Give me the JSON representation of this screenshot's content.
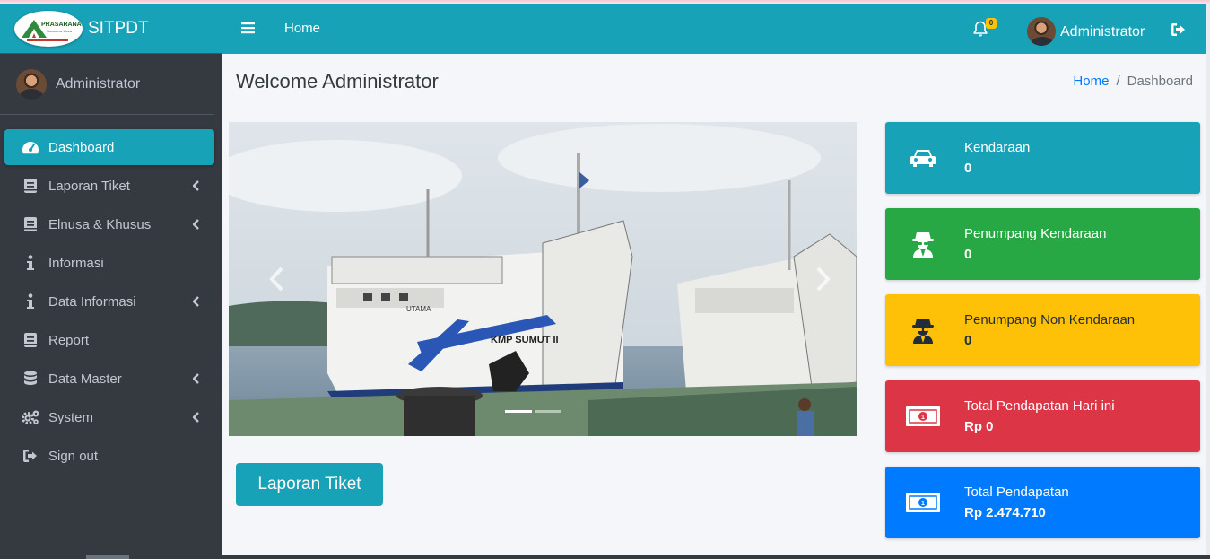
{
  "app": {
    "brand": "SITPDT",
    "logo_text": "PRASARANA",
    "logo_sub": "Sumatera Utara"
  },
  "header": {
    "nav_home": "Home",
    "notification_count": "0",
    "user_name": "Administrator"
  },
  "sidebar": {
    "user_name": "Administrator",
    "items": [
      {
        "label": "Dashboard",
        "icon": "tachometer-icon",
        "active": true,
        "has_caret": false
      },
      {
        "label": "Laporan Tiket",
        "icon": "book-icon",
        "has_caret": true
      },
      {
        "label": "Elnusa & Khusus",
        "icon": "book-icon",
        "has_caret": true
      },
      {
        "label": "Informasi",
        "icon": "info-icon",
        "has_caret": false
      },
      {
        "label": "Data Informasi",
        "icon": "info-icon",
        "has_caret": true
      },
      {
        "label": "Report",
        "icon": "book-icon",
        "has_caret": false
      },
      {
        "label": "Data Master",
        "icon": "database-icon",
        "has_caret": true
      },
      {
        "label": "System",
        "icon": "cogs-icon",
        "has_caret": true
      },
      {
        "label": "Sign out",
        "icon": "sign-out-icon",
        "has_caret": false
      }
    ]
  },
  "main": {
    "title": "Welcome Administrator",
    "breadcrumb": {
      "home": "Home",
      "current": "Dashboard",
      "separator": "/"
    },
    "carousel": {
      "ship_name": "KMP SUMUT II",
      "ship_name_2": "UTAMA"
    },
    "report_button": "Laporan Tiket"
  },
  "stats": [
    {
      "label": "Kendaraan",
      "value": "0",
      "icon": "car-icon",
      "color": "#17a2b8"
    },
    {
      "label": "Penumpang Kendaraan",
      "value": "0",
      "icon": "user-secret-icon",
      "color": "#28a745"
    },
    {
      "label": "Penumpang Non Kendaraan",
      "value": "0",
      "icon": "user-secret-icon",
      "color": "#ffc107"
    },
    {
      "label": "Total Pendapatan Hari ini",
      "value": "Rp 0",
      "icon": "money-bill-icon",
      "color": "#dc3545"
    },
    {
      "label": "Total Pendapatan",
      "value": "Rp 2.474.710",
      "icon": "money-bill-icon",
      "color": "#007bff"
    }
  ],
  "colors": {
    "primary": "#17a2b8",
    "sidebar": "#343a40",
    "success": "#28a745",
    "warning": "#ffc107",
    "danger": "#dc3545",
    "blue": "#007bff"
  }
}
